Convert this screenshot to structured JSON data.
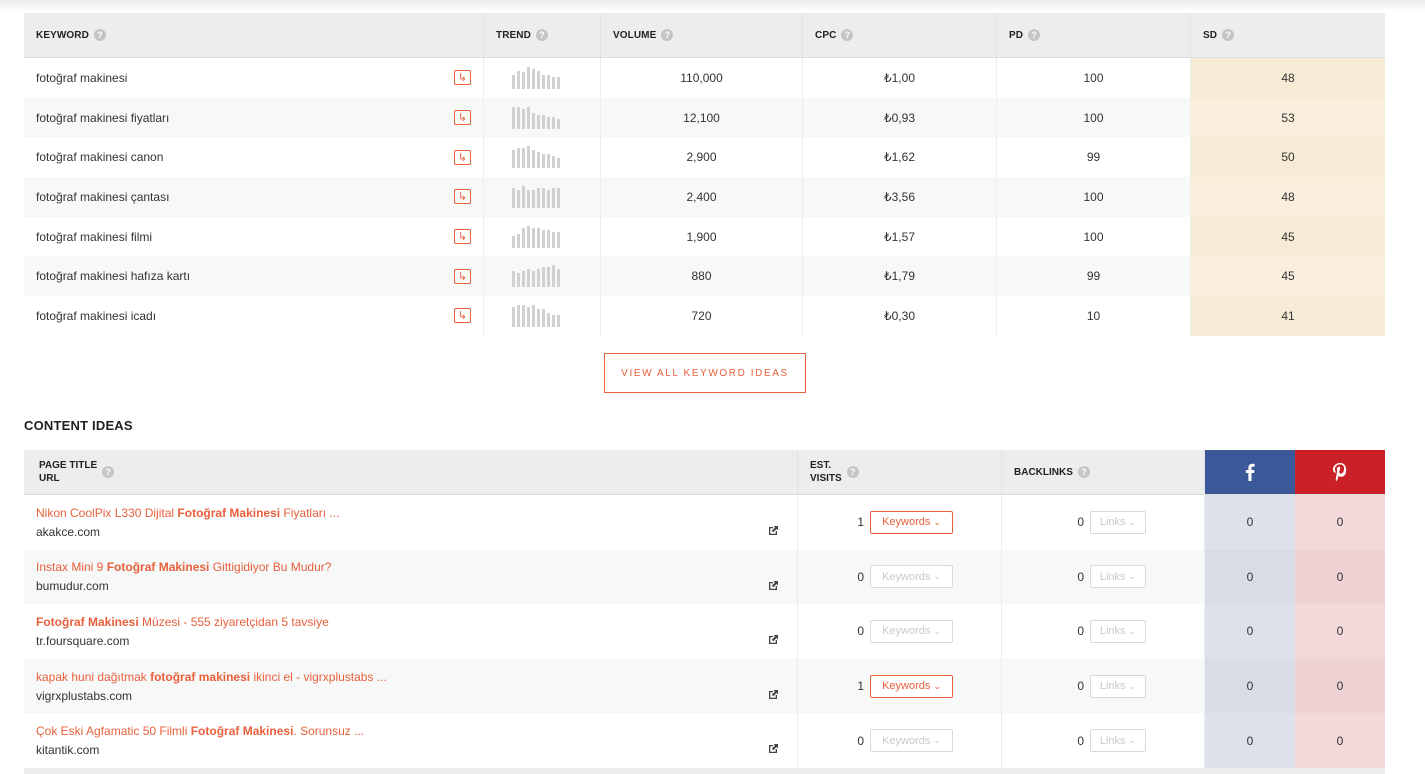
{
  "keywords": {
    "headers": {
      "keyword": "KEYWORD",
      "trend": "TREND",
      "volume": "VOLUME",
      "cpc": "CPC",
      "pd": "PD",
      "sd": "SD"
    },
    "rows": [
      {
        "keyword": "fotoğraf makinesi",
        "volume": "110,000",
        "cpc": "₺1,00",
        "pd": "100",
        "sd": "48",
        "trend": [
          14,
          18,
          17,
          22,
          20,
          18,
          14,
          14,
          12,
          12
        ]
      },
      {
        "keyword": "fotoğraf makinesi fiyatları",
        "volume": "12,100",
        "cpc": "₺0,93",
        "pd": "100",
        "sd": "53",
        "trend": [
          22,
          22,
          20,
          22,
          16,
          14,
          14,
          12,
          12,
          10
        ]
      },
      {
        "keyword": "fotoğraf makinesi canon",
        "volume": "2,900",
        "cpc": "₺1,62",
        "pd": "99",
        "sd": "50",
        "trend": [
          18,
          20,
          20,
          22,
          18,
          16,
          14,
          14,
          12,
          10
        ]
      },
      {
        "keyword": "fotoğraf makinesi çantası",
        "volume": "2,400",
        "cpc": "₺3,56",
        "pd": "100",
        "sd": "48",
        "trend": [
          20,
          18,
          22,
          18,
          18,
          20,
          20,
          18,
          20,
          20
        ]
      },
      {
        "keyword": "fotoğraf makinesi filmi",
        "volume": "1,900",
        "cpc": "₺1,57",
        "pd": "100",
        "sd": "45",
        "trend": [
          12,
          14,
          20,
          22,
          20,
          20,
          18,
          18,
          16,
          16
        ]
      },
      {
        "keyword": "fotoğraf makinesi hafıza kartı",
        "volume": "880",
        "cpc": "₺1,79",
        "pd": "99",
        "sd": "45",
        "trend": [
          16,
          14,
          16,
          18,
          16,
          18,
          20,
          20,
          22,
          18
        ]
      },
      {
        "keyword": "fotoğraf makinesi icadı",
        "volume": "720",
        "cpc": "₺0,30",
        "pd": "10",
        "sd": "41",
        "trend": [
          20,
          22,
          22,
          20,
          22,
          18,
          18,
          14,
          12,
          12
        ]
      }
    ]
  },
  "view_all_label": "VIEW ALL KEYWORD IDEAS",
  "content_ideas": {
    "title": "CONTENT IDEAS",
    "headers": {
      "title_line1": "PAGE TITLE",
      "title_line2": "URL",
      "visits_line1": "EST.",
      "visits_line2": "VISITS",
      "backlinks": "BACKLINKS"
    },
    "rows": [
      {
        "pre": "Nikon CoolPix L330 Dijital ",
        "bold": "Fotoğraf Makinesi",
        "post": " Fiyatları ...",
        "url": "akakce.com",
        "visits": "1",
        "keywords_label": "Keywords",
        "keywords_enabled": true,
        "backlinks": "0",
        "links_label": "Links",
        "fb": "0",
        "pin": "0"
      },
      {
        "pre": "Instax Mini 9 ",
        "bold": "Fotoğraf Makinesi",
        "post": " Gittigidiyor Bu Mudur?",
        "url": "bumudur.com",
        "visits": "0",
        "keywords_label": "Keywords",
        "keywords_enabled": false,
        "backlinks": "0",
        "links_label": "Links",
        "fb": "0",
        "pin": "0"
      },
      {
        "pre": "",
        "bold": "Fotoğraf Makinesi",
        "post": " Müzesi - 555 ziyaretçidan 5 tavsiye",
        "url": "tr.foursquare.com",
        "visits": "0",
        "keywords_label": "Keywords",
        "keywords_enabled": false,
        "backlinks": "0",
        "links_label": "Links",
        "fb": "0",
        "pin": "0"
      },
      {
        "pre": "kapak huni dağıtmak ",
        "bold": "fotoğraf makinesi",
        "post": " ikinci el - vigrxplustabs ...",
        "url": "vigrxplustabs.com",
        "visits": "1",
        "keywords_label": "Keywords",
        "keywords_enabled": true,
        "backlinks": "0",
        "links_label": "Links",
        "fb": "0",
        "pin": "0"
      },
      {
        "pre": "Çok Eski Agfamatic 50 Filmli ",
        "bold": "Fotoğraf Makinesi",
        "post": ". Sorunsuz ...",
        "url": "kitantik.com",
        "visits": "0",
        "keywords_label": "Keywords",
        "keywords_enabled": false,
        "backlinks": "0",
        "links_label": "Links",
        "fb": "0",
        "pin": "0"
      }
    ]
  },
  "colors": {
    "accent": "#e8603c",
    "facebook": "#3b5998",
    "pinterest": "#cb2027",
    "sd_bg": "#f7ebd5"
  },
  "icons": {
    "go": "arrow-right-icon",
    "external": "external-link-icon",
    "help": "question-icon",
    "facebook": "facebook-icon",
    "pinterest": "pinterest-icon",
    "dropdown": "chevron-down-icon"
  }
}
